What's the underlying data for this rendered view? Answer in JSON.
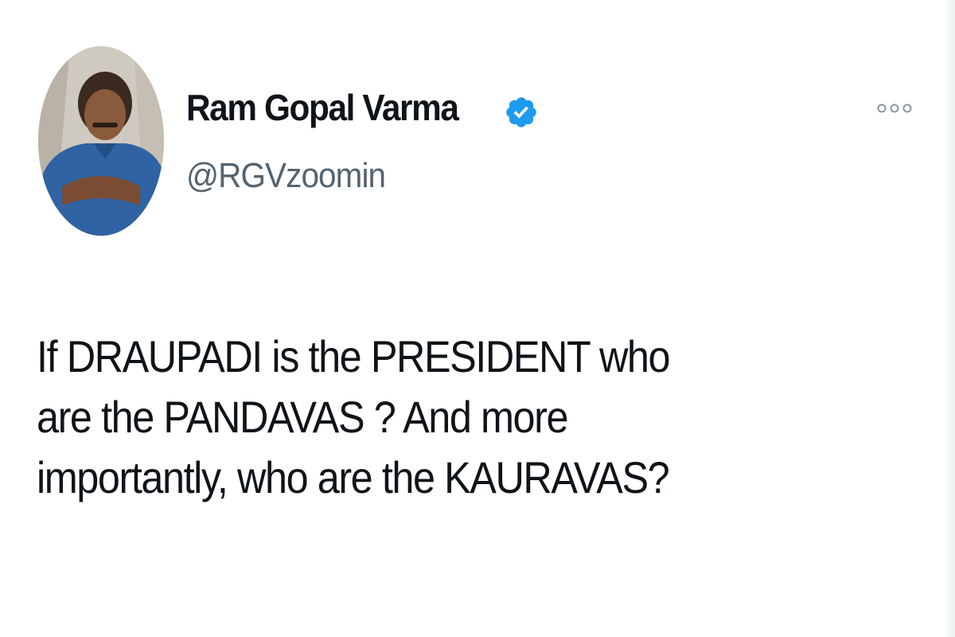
{
  "author": {
    "display_name": "Ram Gopal Varma",
    "handle": "@RGVzoomin",
    "verified_icon": "verified-badge-icon",
    "avatar_icon": "profile-photo"
  },
  "tweet": {
    "lines": [
      "If DRAUPADI is the PRESIDENT who",
      "are the PANDAVAS ? And more",
      "importantly, who are the KAURAVAS?"
    ]
  },
  "more_menu_icon": "more-options-icon",
  "colors": {
    "text": "#0f1419",
    "secondary": "#536471",
    "verified": "#1d9bf0"
  }
}
